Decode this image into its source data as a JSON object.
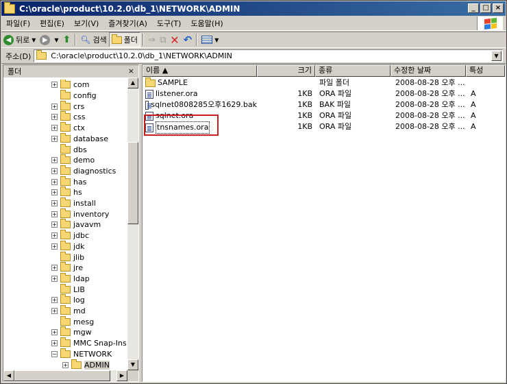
{
  "window": {
    "title": "C:\\oracle\\product\\10.2.0\\db_1\\NETWORK\\ADMIN",
    "minimize_label": "_",
    "maximize_label": "□",
    "close_label": "×"
  },
  "menu": {
    "items": [
      "파일(F)",
      "편집(E)",
      "보기(V)",
      "즐겨찾기(A)",
      "도구(T)",
      "도움말(H)"
    ]
  },
  "toolbar": {
    "back_label": "뒤로",
    "search_label": "검색",
    "folders_label": "폴더",
    "icons": [
      "back-arrow-icon",
      "forward-arrow-icon",
      "up-folder-icon",
      "search-icon",
      "folder-icon",
      "move-to-icon",
      "copy-to-icon",
      "delete-icon",
      "undo-icon",
      "views-icon"
    ],
    "colors": {
      "back": "#2e8b2e",
      "forward": "#8c8c8c",
      "delete": "#d42020",
      "undo": "#1e5fc8"
    }
  },
  "address": {
    "label": "주소(D)",
    "value": "C:\\oracle\\product\\10.2.0\\db_1\\NETWORK\\ADMIN"
  },
  "folder_pane": {
    "title": "폴더",
    "close_label": "×",
    "tree": [
      {
        "label": "com",
        "expandable": true
      },
      {
        "label": "config",
        "expandable": false
      },
      {
        "label": "crs",
        "expandable": true
      },
      {
        "label": "css",
        "expandable": true
      },
      {
        "label": "ctx",
        "expandable": true
      },
      {
        "label": "database",
        "expandable": true
      },
      {
        "label": "dbs",
        "expandable": false
      },
      {
        "label": "demo",
        "expandable": true
      },
      {
        "label": "diagnostics",
        "expandable": true
      },
      {
        "label": "has",
        "expandable": true
      },
      {
        "label": "hs",
        "expandable": true
      },
      {
        "label": "install",
        "expandable": true
      },
      {
        "label": "inventory",
        "expandable": true
      },
      {
        "label": "javavm",
        "expandable": true
      },
      {
        "label": "jdbc",
        "expandable": true
      },
      {
        "label": "jdk",
        "expandable": true
      },
      {
        "label": "jlib",
        "expandable": false
      },
      {
        "label": "jre",
        "expandable": true
      },
      {
        "label": "ldap",
        "expandable": true
      },
      {
        "label": "LIB",
        "expandable": false
      },
      {
        "label": "log",
        "expandable": true
      },
      {
        "label": "md",
        "expandable": true
      },
      {
        "label": "mesg",
        "expandable": false
      },
      {
        "label": "mgw",
        "expandable": true
      },
      {
        "label": "MMC Snap-Ins",
        "expandable": true
      },
      {
        "label": "NETWORK",
        "expandable": true,
        "expanded": true
      },
      {
        "label": "ADMIN",
        "expandable": true,
        "child": true,
        "selected": true
      }
    ]
  },
  "file_list": {
    "columns": [
      "이름 ▲",
      "크기",
      "종류",
      "수정한 날짜",
      "특성"
    ],
    "rows": [
      {
        "name": "SAMPLE",
        "size": "",
        "type": "파일 폴더",
        "modified": "2008-08-28 오후 ...",
        "attr": "",
        "is_folder": true
      },
      {
        "name": "listener.ora",
        "size": "1KB",
        "type": "ORA 파일",
        "modified": "2008-08-28 오후 ...",
        "attr": "A"
      },
      {
        "name": "sqlnet0808285오후1629.bak",
        "size": "1KB",
        "type": "BAK 파일",
        "modified": "2008-08-28 오후 ...",
        "attr": "A"
      },
      {
        "name": "sqlnet.ora",
        "size": "1KB",
        "type": "ORA 파일",
        "modified": "2008-08-28 오후 ...",
        "attr": "A"
      },
      {
        "name": "tnsnames.ora",
        "size": "1KB",
        "type": "ORA 파일",
        "modified": "2008-08-28 오후 ...",
        "attr": "A",
        "focused": true
      }
    ],
    "highlight_color": "#c81e1e"
  }
}
